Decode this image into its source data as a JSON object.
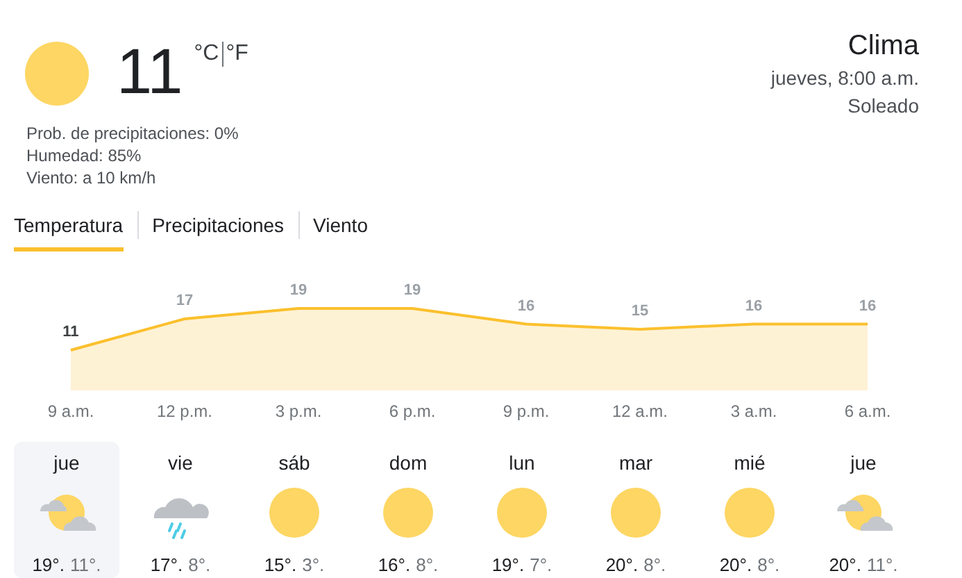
{
  "current": {
    "kind": "sunny",
    "temperature": "11",
    "units": [
      "°C",
      "°F"
    ],
    "details": [
      "Prob. de precipitaciones: 0%",
      "Humedad: 85%",
      "Viento: a 10 km/h"
    ]
  },
  "header": {
    "title": "Clima",
    "datetime": "jueves, 8:00 a.m.",
    "condition": "Soleado"
  },
  "tabs": [
    {
      "label": "Temperatura",
      "selected": true
    },
    {
      "label": "Precipitaciones",
      "selected": false
    },
    {
      "label": "Viento",
      "selected": false
    }
  ],
  "chart_data": {
    "type": "area",
    "categories": [
      "9 a.m.",
      "12 p.m.",
      "3 p.m.",
      "6 p.m.",
      "9 p.m.",
      "12 a.m.",
      "3 a.m.",
      "6 a.m."
    ],
    "series": [
      {
        "color": "#fbc02d",
        "values": [
          11,
          17,
          19,
          19,
          16,
          15,
          16,
          16
        ]
      }
    ],
    "data_labels": true
  },
  "days": [
    {
      "day": "jue",
      "kind": "partly_cloudy",
      "high": "19°.",
      "low": "11°.",
      "selected": true
    },
    {
      "day": "vie",
      "kind": "rain",
      "high": "17°.",
      "low": "8°.",
      "selected": false
    },
    {
      "day": "sáb",
      "kind": "sunny",
      "high": "15°.",
      "low": "3°.",
      "selected": false
    },
    {
      "day": "dom",
      "kind": "sunny",
      "high": "16°.",
      "low": "8°.",
      "selected": false
    },
    {
      "day": "lun",
      "kind": "sunny",
      "high": "19°.",
      "low": "7°.",
      "selected": false
    },
    {
      "day": "mar",
      "kind": "sunny",
      "high": "20°.",
      "low": "8°.",
      "selected": false
    },
    {
      "day": "mié",
      "kind": "sunny",
      "high": "20°.",
      "low": "8°.",
      "selected": false
    },
    {
      "day": "jue",
      "kind": "partly_cloudy",
      "high": "20°.",
      "low": "11°.",
      "selected": false
    }
  ]
}
